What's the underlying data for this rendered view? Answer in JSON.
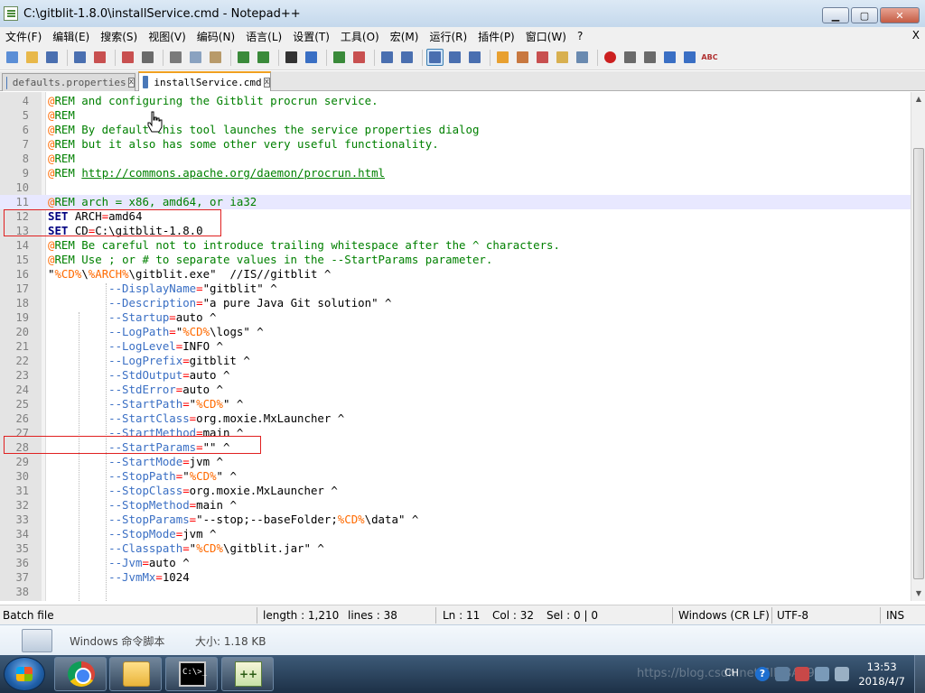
{
  "window": {
    "title": "C:\\gitblit-1.8.0\\installService.cmd - Notepad++",
    "controls": {
      "minimize": "▁",
      "maximize": "▢",
      "close": "✕"
    }
  },
  "menu": {
    "items": [
      "文件(F)",
      "编辑(E)",
      "搜索(S)",
      "视图(V)",
      "编码(N)",
      "语言(L)",
      "设置(T)",
      "工具(O)",
      "宏(M)",
      "运行(R)",
      "插件(P)",
      "窗口(W)",
      "?"
    ],
    "close": "X"
  },
  "toolbar": {
    "icons": [
      "new-file-icon",
      "open-file-icon",
      "save-icon",
      "save-all-icon",
      "close-icon",
      "close-all-icon",
      "print-icon",
      "cut-icon",
      "copy-icon",
      "paste-icon",
      "undo-icon",
      "redo-icon",
      "find-icon",
      "replace-icon",
      "zoom-in-icon",
      "zoom-out-icon",
      "sync-v-icon",
      "sync-h-icon",
      "word-wrap-icon",
      "show-all-chars-icon",
      "indent-guide-icon",
      "udl-icon",
      "doc-map-icon",
      "function-list-icon",
      "folder-workspace-icon",
      "monitoring-icon",
      "record-macro-icon",
      "stop-macro-icon",
      "play-macro-icon",
      "run-macro-multiple-icon",
      "save-macro-icon",
      "spell-check-icon"
    ],
    "spellcheck_label": "ABC"
  },
  "tabs": [
    {
      "label": "defaults.properties",
      "active": false,
      "close": "x"
    },
    {
      "label": "installService.cmd",
      "active": true,
      "close": "x"
    }
  ],
  "editor": {
    "current_line": 11,
    "lines": [
      {
        "n": "4",
        "tokens": [
          [
            "at",
            "@"
          ],
          [
            "rem",
            "REM and configuring the Gitblit procrun service."
          ]
        ]
      },
      {
        "n": "5",
        "tokens": [
          [
            "at",
            "@"
          ],
          [
            "rem",
            "REM"
          ]
        ]
      },
      {
        "n": "6",
        "tokens": [
          [
            "at",
            "@"
          ],
          [
            "rem",
            "REM By default this tool launches the service properties dialog"
          ]
        ]
      },
      {
        "n": "7",
        "tokens": [
          [
            "at",
            "@"
          ],
          [
            "rem",
            "REM but it also has some other very useful functionality."
          ]
        ]
      },
      {
        "n": "8",
        "tokens": [
          [
            "at",
            "@"
          ],
          [
            "rem",
            "REM"
          ]
        ]
      },
      {
        "n": "9",
        "tokens": [
          [
            "at",
            "@"
          ],
          [
            "rem",
            "REM "
          ],
          [
            "url",
            "http://commons.apache.org/daemon/procrun.html"
          ]
        ]
      },
      {
        "n": "10",
        "tokens": []
      },
      {
        "n": "11",
        "tokens": [
          [
            "at",
            "@"
          ],
          [
            "rem",
            "REM arch = x86, amd64, or ia32"
          ]
        ]
      },
      {
        "n": "12",
        "tokens": [
          [
            "kw",
            "SET"
          ],
          [
            "str",
            " ARCH"
          ],
          [
            "op",
            "="
          ],
          [
            "str",
            "amd64"
          ]
        ]
      },
      {
        "n": "13",
        "tokens": [
          [
            "kw",
            "SET"
          ],
          [
            "str",
            " CD"
          ],
          [
            "op",
            "="
          ],
          [
            "str",
            "C:\\gitblit-1.8.0"
          ]
        ]
      },
      {
        "n": "14",
        "tokens": [
          [
            "at",
            "@"
          ],
          [
            "rem",
            "REM Be careful not to introduce trailing whitespace after the ^ characters."
          ]
        ]
      },
      {
        "n": "15",
        "tokens": [
          [
            "at",
            "@"
          ],
          [
            "rem",
            "REM Use ; or # to separate values in the --StartParams parameter."
          ]
        ]
      },
      {
        "n": "16",
        "tokens": [
          [
            "str",
            "\""
          ],
          [
            "var",
            "%CD%"
          ],
          [
            "str",
            "\\"
          ],
          [
            "var",
            "%ARCH%"
          ],
          [
            "str",
            "\\gitblit.exe\"  //IS//gitblit ^"
          ]
        ]
      },
      {
        "n": "17",
        "tokens": [
          [
            "str",
            "         "
          ],
          [
            "opt",
            "--DisplayName"
          ],
          [
            "op",
            "="
          ],
          [
            "str",
            "\"gitblit\" ^"
          ]
        ]
      },
      {
        "n": "18",
        "tokens": [
          [
            "str",
            "         "
          ],
          [
            "opt",
            "--Description"
          ],
          [
            "op",
            "="
          ],
          [
            "str",
            "\"a pure Java Git solution\" ^"
          ]
        ]
      },
      {
        "n": "19",
        "tokens": [
          [
            "str",
            "         "
          ],
          [
            "opt",
            "--Startup"
          ],
          [
            "op",
            "="
          ],
          [
            "str",
            "auto ^"
          ]
        ]
      },
      {
        "n": "20",
        "tokens": [
          [
            "str",
            "         "
          ],
          [
            "opt",
            "--LogPath"
          ],
          [
            "op",
            "="
          ],
          [
            "str",
            "\""
          ],
          [
            "var",
            "%CD%"
          ],
          [
            "str",
            "\\logs\" ^"
          ]
        ]
      },
      {
        "n": "21",
        "tokens": [
          [
            "str",
            "         "
          ],
          [
            "opt",
            "--LogLevel"
          ],
          [
            "op",
            "="
          ],
          [
            "str",
            "INFO ^"
          ]
        ]
      },
      {
        "n": "22",
        "tokens": [
          [
            "str",
            "         "
          ],
          [
            "opt",
            "--LogPrefix"
          ],
          [
            "op",
            "="
          ],
          [
            "str",
            "gitblit ^"
          ]
        ]
      },
      {
        "n": "23",
        "tokens": [
          [
            "str",
            "         "
          ],
          [
            "opt",
            "--StdOutput"
          ],
          [
            "op",
            "="
          ],
          [
            "str",
            "auto ^"
          ]
        ]
      },
      {
        "n": "24",
        "tokens": [
          [
            "str",
            "         "
          ],
          [
            "opt",
            "--StdError"
          ],
          [
            "op",
            "="
          ],
          [
            "str",
            "auto ^"
          ]
        ]
      },
      {
        "n": "25",
        "tokens": [
          [
            "str",
            "         "
          ],
          [
            "opt",
            "--StartPath"
          ],
          [
            "op",
            "="
          ],
          [
            "str",
            "\""
          ],
          [
            "var",
            "%CD%"
          ],
          [
            "str",
            "\" ^"
          ]
        ]
      },
      {
        "n": "26",
        "tokens": [
          [
            "str",
            "         "
          ],
          [
            "opt",
            "--StartClass"
          ],
          [
            "op",
            "="
          ],
          [
            "str",
            "org.moxie.MxLauncher ^"
          ]
        ]
      },
      {
        "n": "27",
        "tokens": [
          [
            "str",
            "         "
          ],
          [
            "opt",
            "--StartMethod"
          ],
          [
            "op",
            "="
          ],
          [
            "str",
            "main ^"
          ]
        ]
      },
      {
        "n": "28",
        "tokens": [
          [
            "str",
            "         "
          ],
          [
            "opt",
            "--StartParams"
          ],
          [
            "op",
            "="
          ],
          [
            "str",
            "\"\" ^"
          ]
        ]
      },
      {
        "n": "29",
        "tokens": [
          [
            "str",
            "         "
          ],
          [
            "opt",
            "--StartMode"
          ],
          [
            "op",
            "="
          ],
          [
            "str",
            "jvm ^"
          ]
        ]
      },
      {
        "n": "30",
        "tokens": [
          [
            "str",
            "         "
          ],
          [
            "opt",
            "--StopPath"
          ],
          [
            "op",
            "="
          ],
          [
            "str",
            "\""
          ],
          [
            "var",
            "%CD%"
          ],
          [
            "str",
            "\" ^"
          ]
        ]
      },
      {
        "n": "31",
        "tokens": [
          [
            "str",
            "         "
          ],
          [
            "opt",
            "--StopClass"
          ],
          [
            "op",
            "="
          ],
          [
            "str",
            "org.moxie.MxLauncher ^"
          ]
        ]
      },
      {
        "n": "32",
        "tokens": [
          [
            "str",
            "         "
          ],
          [
            "opt",
            "--StopMethod"
          ],
          [
            "op",
            "="
          ],
          [
            "str",
            "main ^"
          ]
        ]
      },
      {
        "n": "33",
        "tokens": [
          [
            "str",
            "         "
          ],
          [
            "opt",
            "--StopParams"
          ],
          [
            "op",
            "="
          ],
          [
            "str",
            "\"--stop;--baseFolder;"
          ],
          [
            "var",
            "%CD%"
          ],
          [
            "str",
            "\\data\" ^"
          ]
        ]
      },
      {
        "n": "34",
        "tokens": [
          [
            "str",
            "         "
          ],
          [
            "opt",
            "--StopMode"
          ],
          [
            "op",
            "="
          ],
          [
            "str",
            "jvm ^"
          ]
        ]
      },
      {
        "n": "35",
        "tokens": [
          [
            "str",
            "         "
          ],
          [
            "opt",
            "--Classpath"
          ],
          [
            "op",
            "="
          ],
          [
            "str",
            "\""
          ],
          [
            "var",
            "%CD%"
          ],
          [
            "str",
            "\\gitblit.jar\" ^"
          ]
        ]
      },
      {
        "n": "36",
        "tokens": [
          [
            "str",
            "         "
          ],
          [
            "opt",
            "--Jvm"
          ],
          [
            "op",
            "="
          ],
          [
            "str",
            "auto ^"
          ]
        ]
      },
      {
        "n": "37",
        "tokens": [
          [
            "str",
            "         "
          ],
          [
            "opt",
            "--JvmMx"
          ],
          [
            "op",
            "="
          ],
          [
            "str",
            "1024"
          ]
        ]
      },
      {
        "n": "38",
        "tokens": []
      }
    ]
  },
  "statusbar": {
    "language": "Batch file",
    "length": "length : 1,210",
    "lines": "lines : 38",
    "ln": "Ln : 11",
    "col": "Col : 32",
    "sel": "Sel : 0 | 0",
    "eol": "Windows (CR LF)",
    "encoding": "UTF-8",
    "mode": "INS"
  },
  "details": {
    "file_type": "Windows 命令脚本",
    "file_size": "大小: 1.18 KB"
  },
  "taskbar": {
    "apps": [
      "chrome-icon",
      "explorer-icon",
      "cmd-icon",
      "notepad-plus-plus-icon"
    ],
    "cmd_icon_text": "C:\\>_",
    "npp_icon_text": "++",
    "tray_language": "CH",
    "help_glyph": "?",
    "time": "13:53",
    "date": "2018/4/7",
    "watermark": "https://blog.csdn.net/SIMBA1949"
  },
  "colors": {
    "keyword": "#000080",
    "comment": "#008000",
    "operator": "#ff0000",
    "variable": "#ff6a00",
    "option": "#3a6fc4",
    "current_line": "#e8e8ff",
    "highlight_box": "#e02020"
  }
}
